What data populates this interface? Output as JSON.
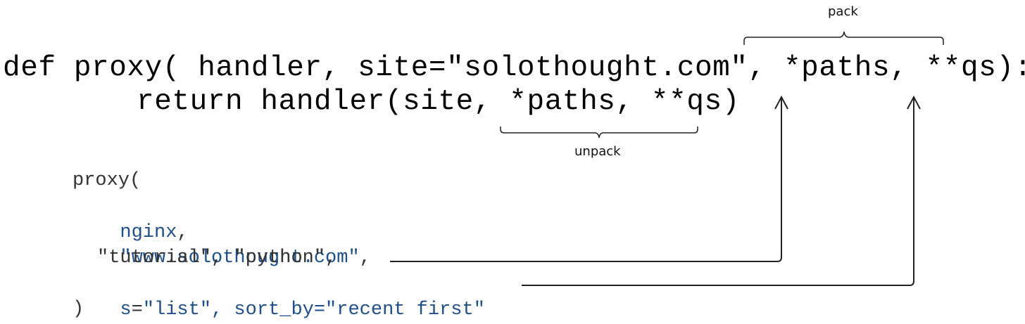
{
  "colors": {
    "text": "#000000",
    "arg_text": "#333333",
    "accent": "#1f4e8a",
    "line": "#222222"
  },
  "code": {
    "def_line": "def proxy( handler, site=\"solothought.com\", *paths, **qs):",
    "return_line": "return handler(site, *paths, **qs)"
  },
  "annotations": {
    "pack_label": "pack",
    "unpack_label": "unpack"
  },
  "call": {
    "open": "proxy(",
    "arg1": "nginx",
    "arg1_suffix": ",",
    "arg2": "\"www.solothought.com\"",
    "arg2_suffix": ",",
    "arg3": "\"tutorial\", \"python\",",
    "arg4_name": "s",
    "arg4_eq": "=",
    "arg4_rest": "\"list\", sort_by=\"recent first\"",
    "close": ")"
  }
}
